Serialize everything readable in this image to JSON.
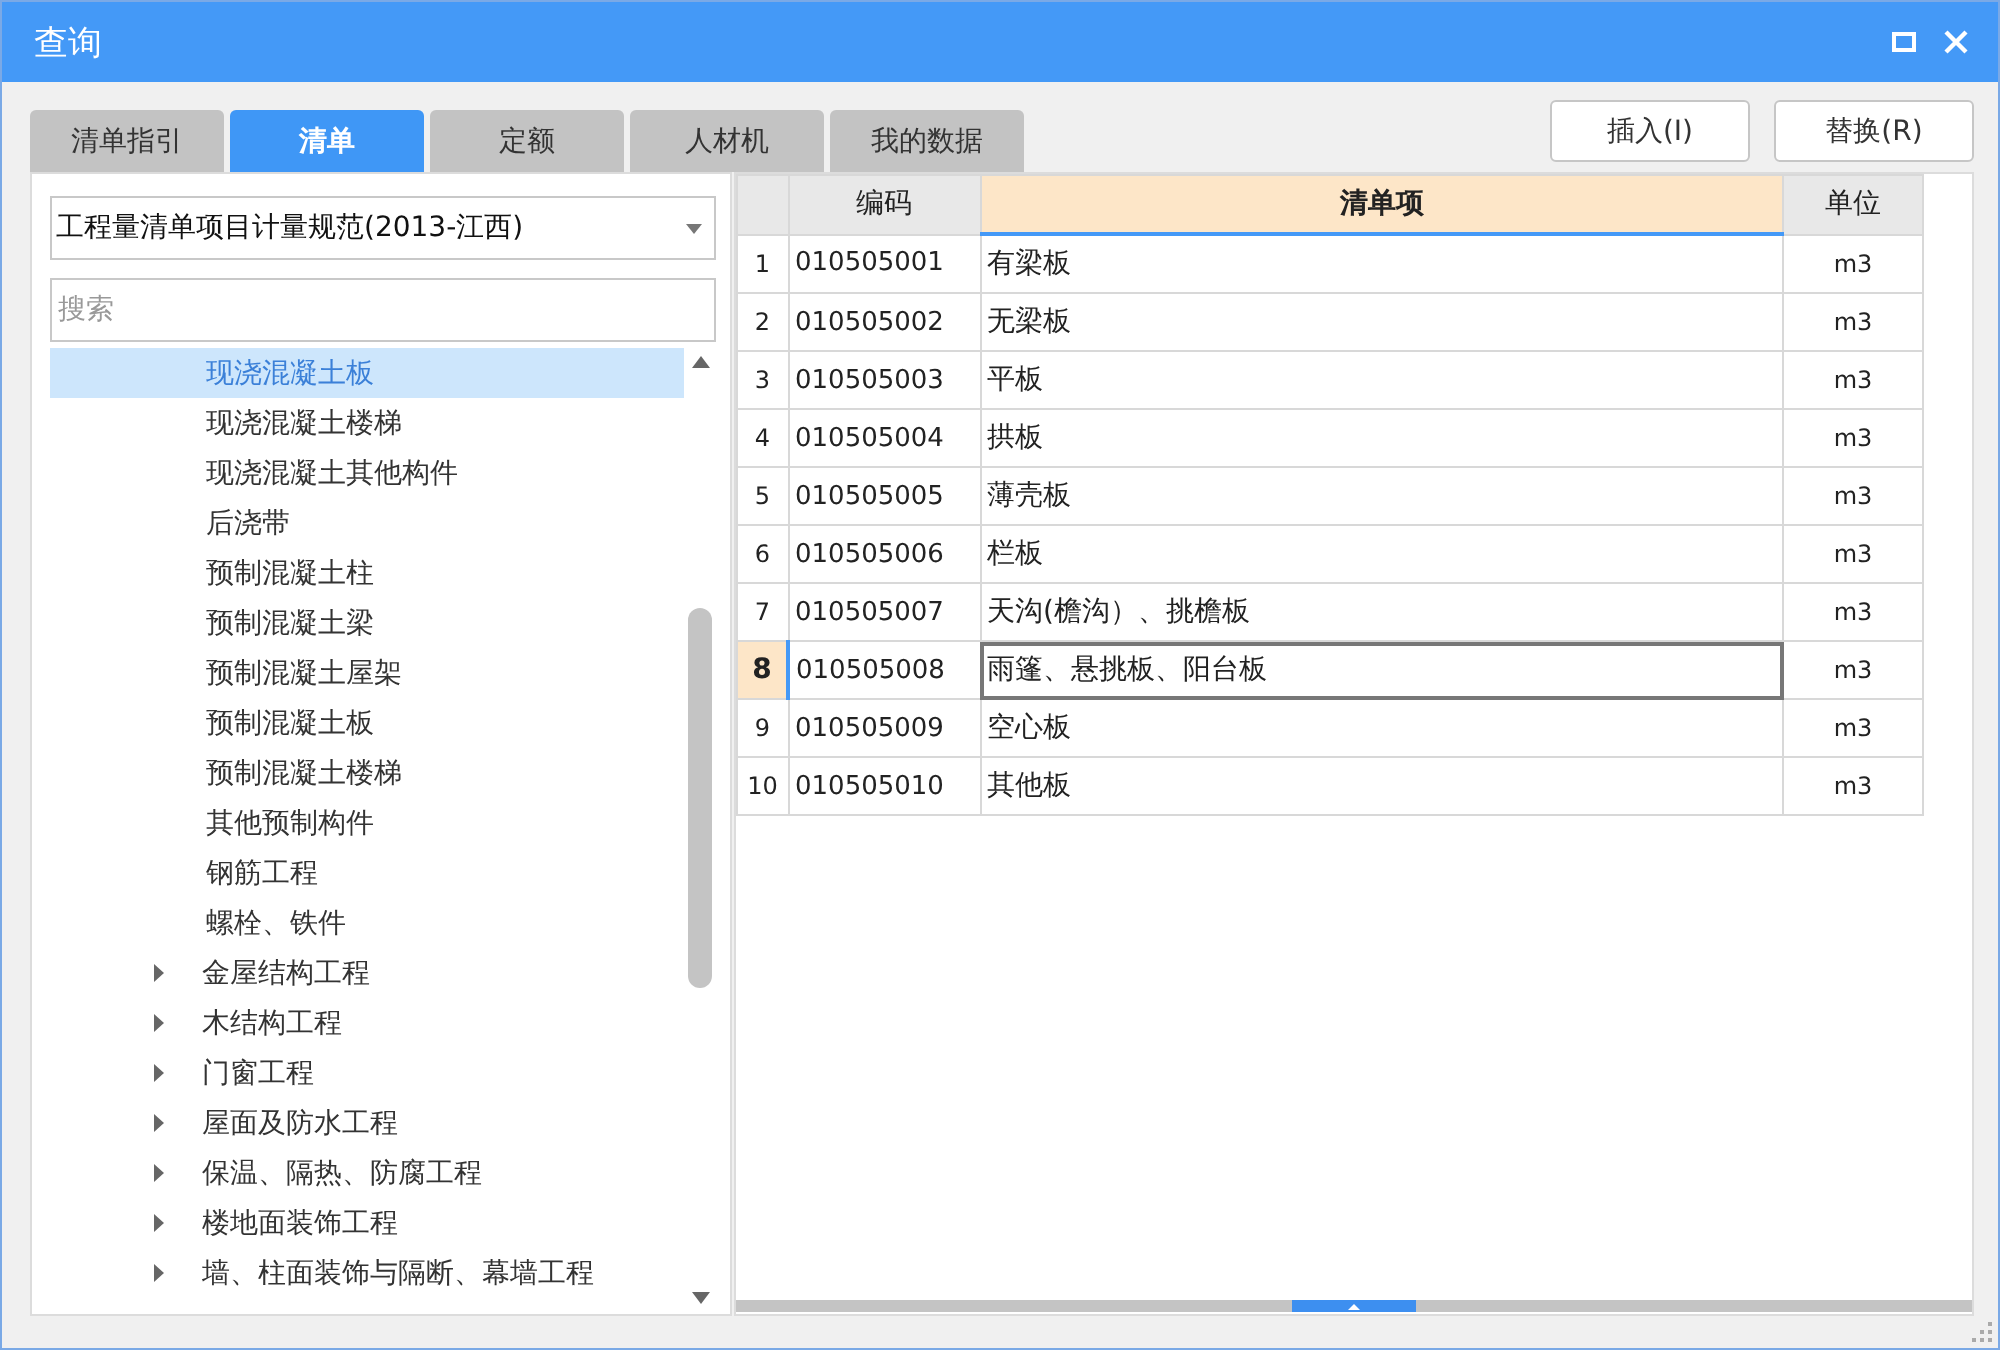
{
  "window": {
    "title": "查询"
  },
  "tabs": [
    {
      "label": "清单指引",
      "selected": false
    },
    {
      "label": "清单",
      "selected": true
    },
    {
      "label": "定额",
      "selected": false
    },
    {
      "label": "人材机",
      "selected": false
    },
    {
      "label": "我的数据",
      "selected": false
    }
  ],
  "buttons": [
    "插入(I)",
    "替换(R)"
  ],
  "library": {
    "value": "工程量清单项目计量规范(2013-江西)"
  },
  "search": {
    "placeholder": "搜索"
  },
  "tree": [
    {
      "children": [
        {
          "label": "现浇混凝土板",
          "selected": true
        },
        {
          "label": "现浇混凝土楼梯",
          "selected": false
        },
        {
          "label": "现浇混凝土其他构件",
          "selected": false
        },
        {
          "label": "后浇带",
          "selected": false
        },
        {
          "label": "预制混凝土柱",
          "selected": false
        },
        {
          "label": "预制混凝土梁",
          "selected": false
        },
        {
          "label": "预制混凝土屋架",
          "selected": false
        },
        {
          "label": "预制混凝土板",
          "selected": false
        },
        {
          "label": "预制混凝土楼梯",
          "selected": false
        },
        {
          "label": "其他预制构件",
          "selected": false
        },
        {
          "label": "钢筋工程",
          "selected": false
        },
        {
          "label": "螺栓、铁件",
          "selected": false
        }
      ]
    },
    {
      "label": "金屋结构工程",
      "selected": false,
      "expanded": false
    },
    {
      "label": "木结构工程",
      "selected": false,
      "expanded": false
    },
    {
      "label": "门窗工程",
      "selected": false,
      "expanded": false
    },
    {
      "label": "屋面及防水工程",
      "selected": false,
      "expanded": false
    },
    {
      "label": "保温、隔热、防腐工程",
      "selected": false,
      "expanded": false
    },
    {
      "label": "楼地面装饰工程",
      "selected": false,
      "expanded": false
    },
    {
      "label": "墙、柱面装饰与隔断、幕墙工程",
      "selected": false,
      "expanded": false
    }
  ],
  "table": {
    "columns": [
      {
        "label": "编码",
        "selected": false
      },
      {
        "label": "清单项",
        "selected": true
      },
      {
        "label": "单位",
        "selected": false
      }
    ],
    "rows": [
      {
        "index": "1",
        "code": "010505001",
        "item": "有梁板",
        "unit": "m3",
        "selected": false
      },
      {
        "index": "2",
        "code": "010505002",
        "item": "无梁板",
        "unit": "m3",
        "selected": false
      },
      {
        "index": "3",
        "code": "010505003",
        "item": "平板",
        "unit": "m3",
        "selected": false
      },
      {
        "index": "4",
        "code": "010505004",
        "item": "拱板",
        "unit": "m3",
        "selected": false
      },
      {
        "index": "5",
        "code": "010505005",
        "item": "薄壳板",
        "unit": "m3",
        "selected": false
      },
      {
        "index": "6",
        "code": "010505006",
        "item": "栏板",
        "unit": "m3",
        "selected": false
      },
      {
        "index": "7",
        "code": "010505007",
        "item": "天沟(檐沟）、挑檐板",
        "unit": "m3",
        "selected": false
      },
      {
        "index": "8",
        "code": "010505008",
        "item": "雨篷、悬挑板、阳台板",
        "unit": "m3",
        "selected": true
      },
      {
        "index": "9",
        "code": "010505009",
        "item": "空心板",
        "unit": "m3",
        "selected": false
      },
      {
        "index": "10",
        "code": "010505010",
        "item": "其他板",
        "unit": "m3",
        "selected": false
      }
    ]
  }
}
